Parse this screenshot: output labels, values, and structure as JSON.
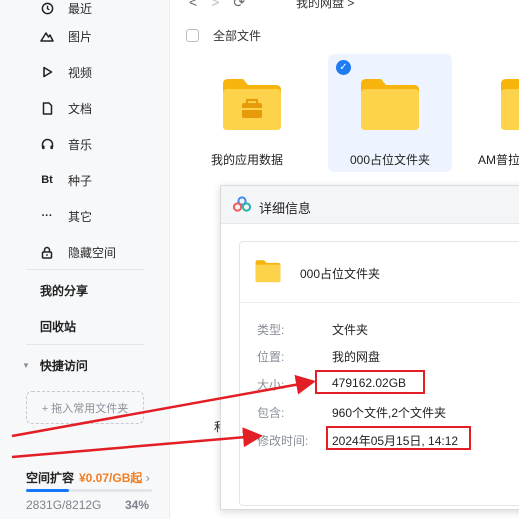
{
  "sidebar": {
    "items": [
      {
        "label": "最近",
        "icon": "clock-icon"
      },
      {
        "label": "图片",
        "icon": "mountain-icon"
      },
      {
        "label": "视频",
        "icon": "play-icon"
      },
      {
        "label": "文档",
        "icon": "document-icon"
      },
      {
        "label": "音乐",
        "icon": "headphones-icon"
      },
      {
        "label": "种子",
        "icon": "bt-icon",
        "glyph": "Bt"
      },
      {
        "label": "其它",
        "icon": "more-icon",
        "glyph": "···"
      },
      {
        "label": "隐藏空间",
        "icon": "lock-icon"
      }
    ],
    "my_share": "我的分享",
    "recycle_bin": "回收站",
    "quick_access": "快捷访问",
    "drag_hint": "+ 拖入常用文件夹",
    "storage": {
      "title": "空间扩容",
      "price": "¥0.07/GB起",
      "used": "2831G/8212G",
      "percent_text": "34%",
      "percent": 34
    }
  },
  "main": {
    "breadcrumb": "我的网盘 >",
    "select_all": "全部文件",
    "folders": [
      {
        "name": "我的应用数据",
        "selected": false
      },
      {
        "name": "000占位文件夹",
        "selected": true
      },
      {
        "name": "AM普拉",
        "selected": false
      }
    ],
    "partial_text": "和"
  },
  "dialog": {
    "title": "详细信息",
    "folder_name": "000占位文件夹",
    "rows": [
      {
        "label": "类型:",
        "value": "文件夹"
      },
      {
        "label": "位置:",
        "value": "我的网盘"
      },
      {
        "label": "大小:",
        "value": "479162.02GB"
      },
      {
        "label": "包含:",
        "value": "960个文件,2个文件夹"
      },
      {
        "label": "修改时间:",
        "value": "2024年05月15日, 14:12"
      }
    ]
  },
  "colors": {
    "accent": "#1677ff",
    "price": "#f27d21",
    "annotation": "#e31e24",
    "folder": "#fbc02d"
  }
}
